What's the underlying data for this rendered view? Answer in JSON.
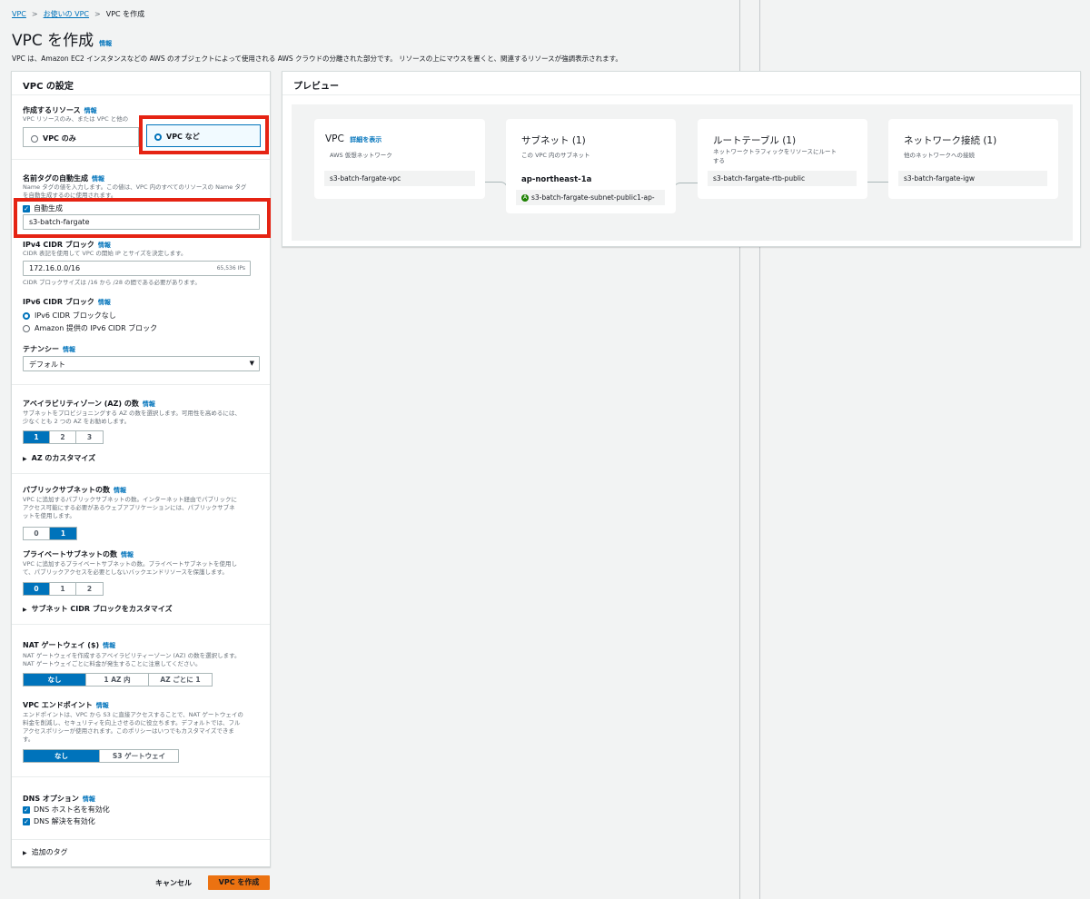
{
  "breadcrumb": [
    "VPC",
    "お使いの VPC",
    "VPC を作成"
  ],
  "page": {
    "title": "VPC を作成",
    "info": "情報",
    "description": "VPC は、Amazon EC2 インスタンスなどの AWS のオブジェクトによって使用される AWS クラウドの分離された部分です。 リソースの上にマウスを置くと、関連するリソースが強調表示されます。"
  },
  "settings": {
    "title": "VPC の設定",
    "info": "情報",
    "resources": {
      "label": "作成するリソース",
      "hint": "VPC リソースのみ、または VPC と他の",
      "options": [
        "VPC のみ",
        "VPC など"
      ],
      "selected": "VPC など"
    },
    "name_tag": {
      "label": "名前タグの自動生成",
      "hint1": "Name タグの値を入力します。この値は、VPC 内のすべてのリソースの Name タグ",
      "hint2": "を自動生成するのに使用されます。",
      "auto_label": "自動生成",
      "value": "s3-batch-fargate"
    },
    "ipv4": {
      "label": "IPv4 CIDR ブロック",
      "hint": "CIDR 表記を使用して VPC の開始 IP とサイズを決定します。",
      "value": "172.16.0.0/16",
      "ips": "65,536 IPs",
      "constraint": "CIDR ブロックサイズは /16 から /28 の間である必要があります。"
    },
    "ipv6": {
      "label": "IPv6 CIDR ブロック",
      "options": [
        "IPv6 CIDR ブロックなし",
        "Amazon 提供の IPv6 CIDR ブロック"
      ]
    },
    "tenancy": {
      "label": "テナンシー",
      "value": "デフォルト"
    },
    "az": {
      "label": "アベイラビリティゾーン (AZ) の数",
      "hint1": "サブネットをプロビジョニングする AZ の数を選択します。可用性を高めるには、",
      "hint2": "少なくとも 2 つの AZ をお勧めします。",
      "options": [
        "1",
        "2",
        "3"
      ],
      "customize": "AZ のカスタマイズ"
    },
    "public_subnets": {
      "label": "パブリックサブネットの数",
      "hint1": "VPC に追加するパブリックサブネットの数。インターネット経由でパブリックに",
      "hint2": "アクセス可能にする必要があるウェブアプリケーションには、パブリックサブネ",
      "hint3": "ットを使用します。",
      "options": [
        "0",
        "1"
      ]
    },
    "private_subnets": {
      "label": "プライベートサブネットの数",
      "hint1": "VPC に追加するプライベートサブネットの数。プライベートサブネットを使用し",
      "hint2": "て、パブリックアクセスを必要としないバックエンドリソースを保護します。",
      "options": [
        "0",
        "1",
        "2"
      ],
      "customize": "サブネット CIDR ブロックをカスタマイズ"
    },
    "nat": {
      "label": "NAT ゲートウェイ ($)",
      "hint1": "NAT ゲートウェイを作成するアベイラビリティーゾーン (AZ) の数を選択します。",
      "hint2": "NAT ゲートウェイごとに料金が発生することに注意してください。",
      "options": [
        "なし",
        "1 AZ 内",
        "AZ ごとに 1"
      ]
    },
    "endpoint": {
      "label": "VPC エンドポイント",
      "hint1": "エンドポイントは、VPC から S3 に直接アクセスすることで、NAT ゲートウェイの",
      "hint2": "料金を削減し、セキュリティを向上させるのに役立ちます。デフォルトでは、フル",
      "hint3": "アクセスポリシーが使用されます。このポリシーはいつでもカスタマイズできま",
      "hint4": "す。",
      "options": [
        "なし",
        "S3 ゲートウェイ"
      ]
    },
    "dns": {
      "label": "DNS オプション",
      "options": [
        "DNS ホスト名を有効化",
        "DNS 解決を有効化"
      ]
    },
    "tags": "追加のタグ"
  },
  "footer": {
    "cancel": "キャンセル",
    "create": "VPC を作成"
  },
  "preview": {
    "title": "プレビュー",
    "vpc": {
      "title": "VPC",
      "detail_link": "詳細を表示",
      "sub": "AWS 仮想ネットワーク",
      "item": "s3-batch-fargate-vpc"
    },
    "subnet": {
      "title": "サブネット (1)",
      "sub": "この VPC 内のサブネット",
      "az": "ap-northeast-1a",
      "item": "s3-batch-fargate-subnet-public1-ap-"
    },
    "route": {
      "title": "ルートテーブル (1)",
      "sub1": "ネットワークトラフィックをリソースにルート",
      "sub2": "する",
      "item": "s3-batch-fargate-rtb-public"
    },
    "network": {
      "title": "ネットワーク接続 (1)",
      "sub": "他のネットワークへの接続",
      "item": "s3-batch-fargate-igw"
    }
  },
  "colors": {
    "accent": "#0073bb",
    "primary_button": "#ec7211",
    "highlight": "#e52313",
    "status_ok": "#1d8102"
  }
}
